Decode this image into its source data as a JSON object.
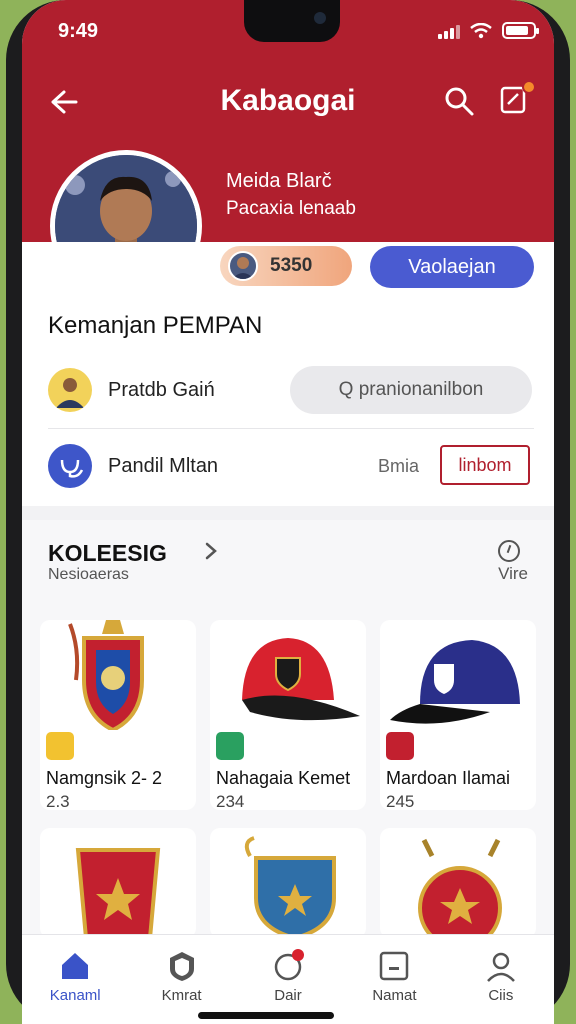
{
  "status_bar": {
    "time": "9:49"
  },
  "header": {
    "title": "Kabaogai",
    "back_icon": "arrow-left-icon",
    "search_icon": "search-icon",
    "notif_icon": "notification-icon"
  },
  "profile": {
    "name": "Meida Blarč",
    "subtitle": "Pacaxia lenaab",
    "points": "5350",
    "primary_button": "Vaolaejan"
  },
  "account": {
    "title": "Kemanjan PEMPAN",
    "row1_label": "Pratdb Gaiń",
    "search_placeholder": "Q pranionanilbon",
    "row2_label": "Pandil Mltan",
    "link": "Bmia",
    "outline_button": "linbom"
  },
  "collection": {
    "title": "KOLEESIG",
    "subtitle": "Nesioaeras",
    "more_label": "Vire",
    "items": [
      {
        "name": "Namgnsik 2- 2",
        "count": "2.3"
      },
      {
        "name": "Nahagaia Kemet",
        "count": "234"
      },
      {
        "name": "Mardoan Ilamai",
        "count": "245"
      },
      {
        "name": "",
        "count": ""
      },
      {
        "name": "",
        "count": ""
      },
      {
        "name": "",
        "count": ""
      }
    ]
  },
  "tabs": [
    {
      "label": "Kanaml",
      "icon": "home-icon"
    },
    {
      "label": "Kmrat",
      "icon": "shield-icon"
    },
    {
      "label": "Dair",
      "icon": "circle-notification-icon"
    },
    {
      "label": "Namat",
      "icon": "box-icon"
    },
    {
      "label": "Ciis",
      "icon": "user-icon"
    }
  ],
  "colors": {
    "brand_red": "#b01f2e",
    "accent_blue": "#4a5bd1",
    "points_orange": "#f0a57c"
  }
}
